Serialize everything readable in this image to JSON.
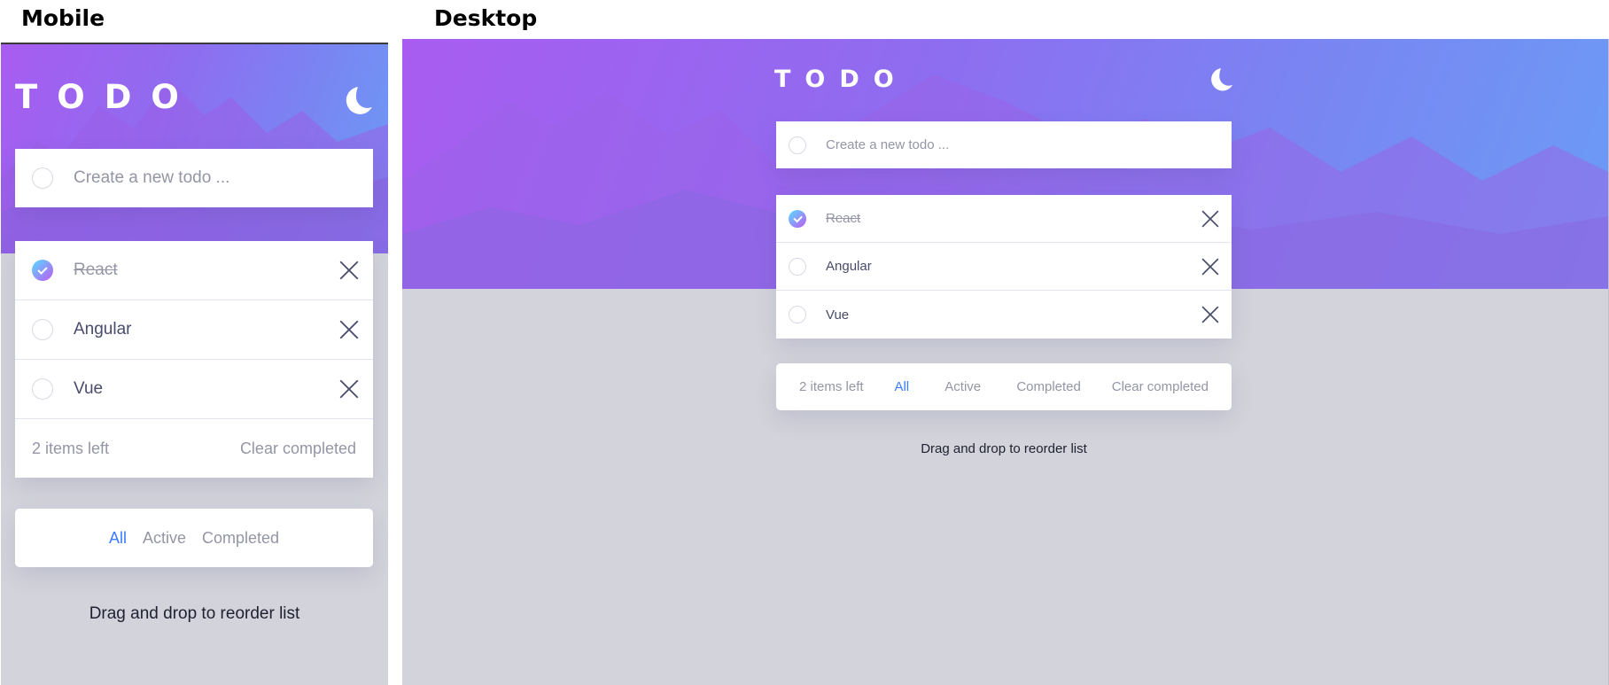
{
  "labels": {
    "mobile": "Mobile",
    "desktop": "Desktop"
  },
  "app": {
    "logo": "TODO",
    "theme_icon": "moon-icon",
    "new_placeholder": "Create a new todo ..."
  },
  "todos": [
    {
      "text": "React",
      "completed": true
    },
    {
      "text": "Angular",
      "completed": false
    },
    {
      "text": "Vue",
      "completed": false
    }
  ],
  "footer": {
    "items_left": "2 items left",
    "clear": "Clear completed",
    "filters": [
      "All",
      "Active",
      "Completed"
    ],
    "active_filter": "All"
  },
  "hint": "Drag and drop to reorder list",
  "colors": {
    "accent": "#3a7cfd",
    "gradient_start": "#a85cf0",
    "gradient_end": "#6b9cf6",
    "background": "#d2d3db"
  }
}
